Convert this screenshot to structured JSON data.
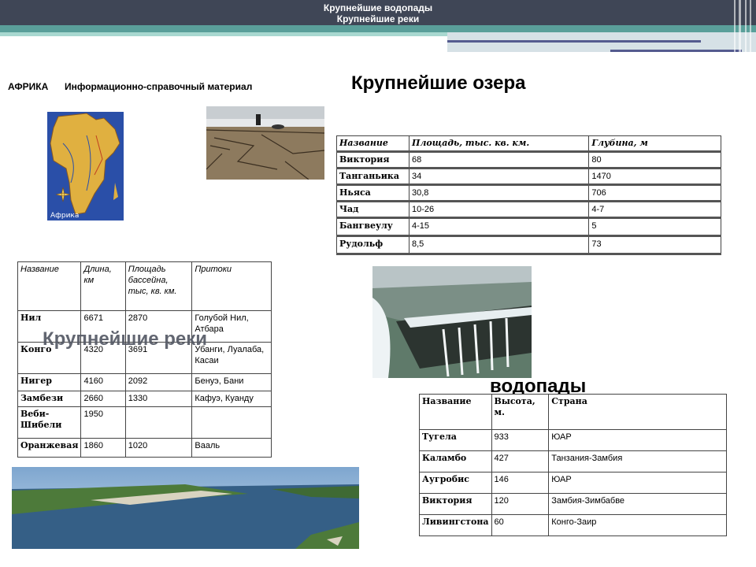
{
  "header": {
    "line1": "Крупнейшие водопады",
    "line2": "Крупнейшие реки"
  },
  "labels": {
    "africa": "АФРИКА",
    "info": "Информационно-справочный материал",
    "lakes_title": "Крупнейшие озера",
    "rivers_title": "Крупнейшие реки",
    "falls_title": "водопады"
  },
  "map": {
    "caption": "Африка"
  },
  "lakes": {
    "headers": [
      "Название",
      "Площадь, тыс. кв. км.",
      "Глубина, м"
    ],
    "rows": [
      [
        "Виктория",
        "68",
        "80"
      ],
      [
        "Танганьика",
        "34",
        "1470"
      ],
      [
        "Ньяса",
        "30,8",
        "706"
      ],
      [
        "Чад",
        "10-26",
        "4-7"
      ],
      [
        "Бангвеулу",
        "4-15",
        "5"
      ],
      [
        "Рудольф",
        "8,5",
        "73"
      ]
    ]
  },
  "rivers": {
    "headers": [
      "Название",
      "Длина, км",
      "Площадь бассейна, тыс, кв. км.",
      "Притоки"
    ],
    "rows": [
      [
        "Нил",
        "6671",
        "2870",
        "Голубой Нил, Атбара"
      ],
      [
        "Конго",
        "4320",
        "3691",
        "Убанги, Луалаба, Касаи"
      ],
      [
        "Нигер",
        "4160",
        "2092",
        "Бенуэ, Бани"
      ],
      [
        "Замбези",
        "2660",
        "1330",
        "Кафуэ, Куанду"
      ],
      [
        "Веби-Шибели",
        "1950",
        "",
        ""
      ],
      [
        "Оранжевая",
        "1860",
        "1020",
        "Вааль"
      ]
    ]
  },
  "falls": {
    "headers": [
      "Название",
      "Высота, м.",
      "Страна"
    ],
    "rows": [
      [
        "Тугела",
        "933",
        "ЮАР"
      ],
      [
        "Каламбо",
        "427",
        "Танзания-Замбия"
      ],
      [
        "Аугробис",
        "146",
        "ЮАР"
      ],
      [
        "Виктория",
        "120",
        "Замбия-Зимбабве"
      ],
      [
        "Ливингстона",
        "60",
        "Конго-Заир"
      ]
    ]
  },
  "colors": {
    "header_bg": "#3f4656",
    "teal_band": "#5a9f9a",
    "accent_line": "#545b8f"
  }
}
